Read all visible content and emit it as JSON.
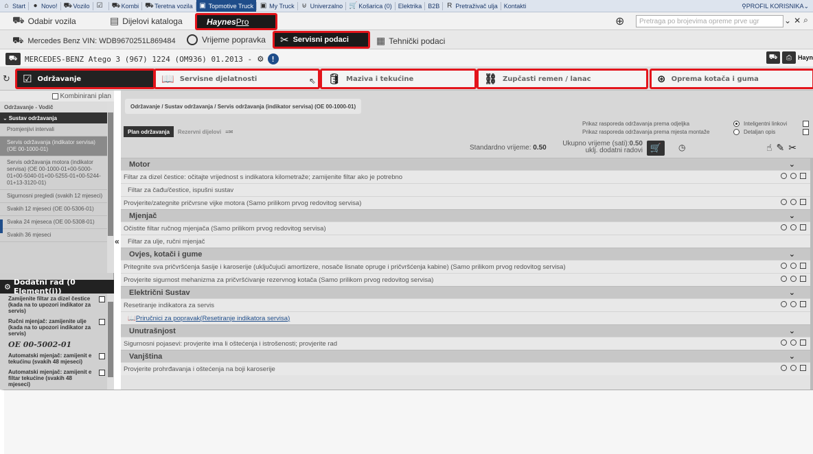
{
  "topbar": {
    "items": [
      {
        "icon": "home-icon",
        "glyph": "⌂",
        "label": "Start"
      },
      {
        "icon": "record-icon",
        "glyph": "●",
        "label": "Novo!"
      },
      {
        "icon": "car-icon",
        "glyph": "⛟",
        "label": "Vozilo"
      },
      {
        "icon": "check-icon",
        "glyph": "☑",
        "label": ""
      },
      {
        "icon": "van-icon",
        "glyph": "⛟",
        "label": "Kombi"
      },
      {
        "icon": "truck-icon",
        "glyph": "⛟",
        "label": "Teretna vozila"
      },
      {
        "icon": "topmotive-truck-icon",
        "glyph": "▣",
        "label": "Topmotive Truck",
        "active": true
      },
      {
        "icon": "my-truck-icon",
        "glyph": "▣",
        "label": "My Truck"
      },
      {
        "icon": "universal-icon",
        "glyph": "⊍",
        "label": "Univerzalno"
      },
      {
        "icon": "cart-icon",
        "glyph": "🛒",
        "label": "Košarica (0)"
      },
      {
        "icon": "",
        "glyph": "",
        "label": "Elektrika"
      },
      {
        "icon": "",
        "glyph": "",
        "label": "B2B"
      },
      {
        "icon": "oil-search-icon",
        "glyph": "R",
        "label": "Pretraživač ulja"
      },
      {
        "icon": "",
        "glyph": "",
        "label": "Kontakti"
      }
    ],
    "profile": "PROFIL KORISNIKA"
  },
  "row2": {
    "odabir": "Odabir vozila",
    "dijelovi": "Dijelovi kataloga",
    "haynes_main": "Haynes",
    "haynes_pro": "Pro",
    "search_placeholder": "Pretraga po brojevima opreme prve ugr"
  },
  "row3": {
    "vin": "Mercedes Benz VIN: WDB9670251L869484",
    "vrijeme": "Vrijeme popravka",
    "servisni": "Servisni podaci",
    "tehnicki": "Tehnički podaci"
  },
  "vehicle": {
    "name": "MERCEDES-BENZ Atego 3 (967) 1224 (OM936) 01.2013 -",
    "brand": "HaynesPro"
  },
  "tabs": [
    {
      "label": "Održavanje",
      "active": true,
      "icon": "checklist-icon",
      "glyph": "☑"
    },
    {
      "label": "Servisne djelatnosti",
      "active": false,
      "icon": "book-icon",
      "glyph": "📖"
    },
    {
      "label": "Maziva i tekućine",
      "active": false,
      "icon": "oilcan-icon",
      "glyph": "🛢"
    },
    {
      "label": "Zupčasti remen / lanac",
      "active": false,
      "icon": "chain-icon",
      "glyph": "⛓"
    },
    {
      "label": "Oprema kotača i guma",
      "active": false,
      "icon": "wheel-icon",
      "glyph": "⊛"
    }
  ],
  "sidebar": {
    "kombinirani": "Kombinirani plan",
    "vodic": "Održavanje - Vodič",
    "sustav": "Sustav održavanja",
    "items": [
      {
        "text": "Promjenjivi intervali",
        "sel": false
      },
      {
        "text": "Servis održavanja (indikator servisa) (OE 00-1000-01)",
        "sel": true
      },
      {
        "text": "Servis održavanja motora (indikator servisa) (OE 00-1000-01+00-5000-01+00-5040-01+00-5255-01+00-5244-01+13-3120-01)",
        "sel": false
      },
      {
        "text": "Sigurnosni pregledi (svakih 12 mjeseci)",
        "sel": false
      },
      {
        "text": "Svakih 12 mjeseci (OE 00-5306-01)",
        "sel": false
      },
      {
        "text": "Svaka 24 mjeseca (OE 00-5308-01)",
        "sel": false
      },
      {
        "text": "Svakih 36 mjeseci",
        "sel": false
      }
    ],
    "dodatni_title": "Dodatni rad (0 Element(i))",
    "dodatni": [
      {
        "text": "Zamijenite filtar za dizel čestice (kada na to upozori indikator za servis)"
      },
      {
        "text": "Ručni mjenjač: zamijenite ulje (kada na to upozori indikator za servis)"
      },
      {
        "code": "OE 00-5002-01"
      },
      {
        "text": "Automatski mjenjač: zamijenit e tekućinu (svakih 48 mjeseci)"
      },
      {
        "text": "Automatski mjenjač: zamijenit e filtar tekućine (svakih 48 mjeseci)"
      }
    ]
  },
  "main": {
    "breadcrumb": "Održavanje / Sustav održavanja / Servis održavanja (indikator servisa) (OE 00-1000-01)",
    "subtab_plan": "Plan održavanja",
    "subtab_rez": "Rezervni dijelovi",
    "opt1": "Prikaz rasporeda održavanja prema odjeljka",
    "opt2": "Prikaz rasporeda održavanja prema mjesta montaže",
    "opt1b": "Inteligentni linkovi",
    "opt2b": "Detaljan opis",
    "std_label": "Standardno vrijeme:",
    "std_value": "0.50",
    "tot_label": "Ukupno vrijeme (sati):",
    "tot_value": "0.50",
    "tot_sub": "uklj. dodatni radovi"
  },
  "rows": [
    {
      "type": "head",
      "text": "Motor"
    },
    {
      "type": "op",
      "text": "Filtar za dizel čestice: očitajte vrijednost s indikatora kilometraže; zamijenite filtar ako je potrebno",
      "ctrls": true
    },
    {
      "type": "sub",
      "text": "Filtar za čađu/čestice, ispušni sustav",
      "ctrls": false
    },
    {
      "type": "op",
      "text": "Provjerite/zategnite pričvrsne vijke motora (Samo prilikom prvog redovitog servisa)",
      "ctrls": true
    },
    {
      "type": "head",
      "text": "Mjenjač"
    },
    {
      "type": "op",
      "text": "Očistite filtar ručnog mjenjača (Samo prilikom prvog redovitog servisa)",
      "ctrls": true
    },
    {
      "type": "sub",
      "text": "Filtar za ulje, ručni mjenjač",
      "ctrls": false
    },
    {
      "type": "head",
      "text": "Ovjes, kotači i gume"
    },
    {
      "type": "op",
      "text": "Pritegnite sva pričvršćenja šasije i karoserije (uključujući amortizere, nosače lisnate opruge i pričvršćenja kabine) (Samo prilikom prvog redovitog servisa)",
      "ctrls": true
    },
    {
      "type": "op",
      "text": "Provjerite sigurnost mehanizma za pričvršćivanje rezervnog kotača (Samo prilikom prvog redovitog servisa)",
      "ctrls": true
    },
    {
      "type": "head",
      "text": "Električni Sustav"
    },
    {
      "type": "op",
      "text": "Resetiranje indikatora za servis",
      "ctrls": true
    },
    {
      "type": "link",
      "text": "Priručnici za popravak(Resetiranje indikatora servisa)",
      "ctrls": false
    },
    {
      "type": "head",
      "text": "Unutrašnjost"
    },
    {
      "type": "op",
      "text": "Sigurnosni pojasevi: provjerite ima li oštećenja i istrošenosti; provjerite rad",
      "ctrls": true
    },
    {
      "type": "head",
      "text": "Vanjština"
    },
    {
      "type": "op",
      "text": "Provjerite prohrđavanja i oštećenja na boji karoserije",
      "ctrls": true
    }
  ]
}
